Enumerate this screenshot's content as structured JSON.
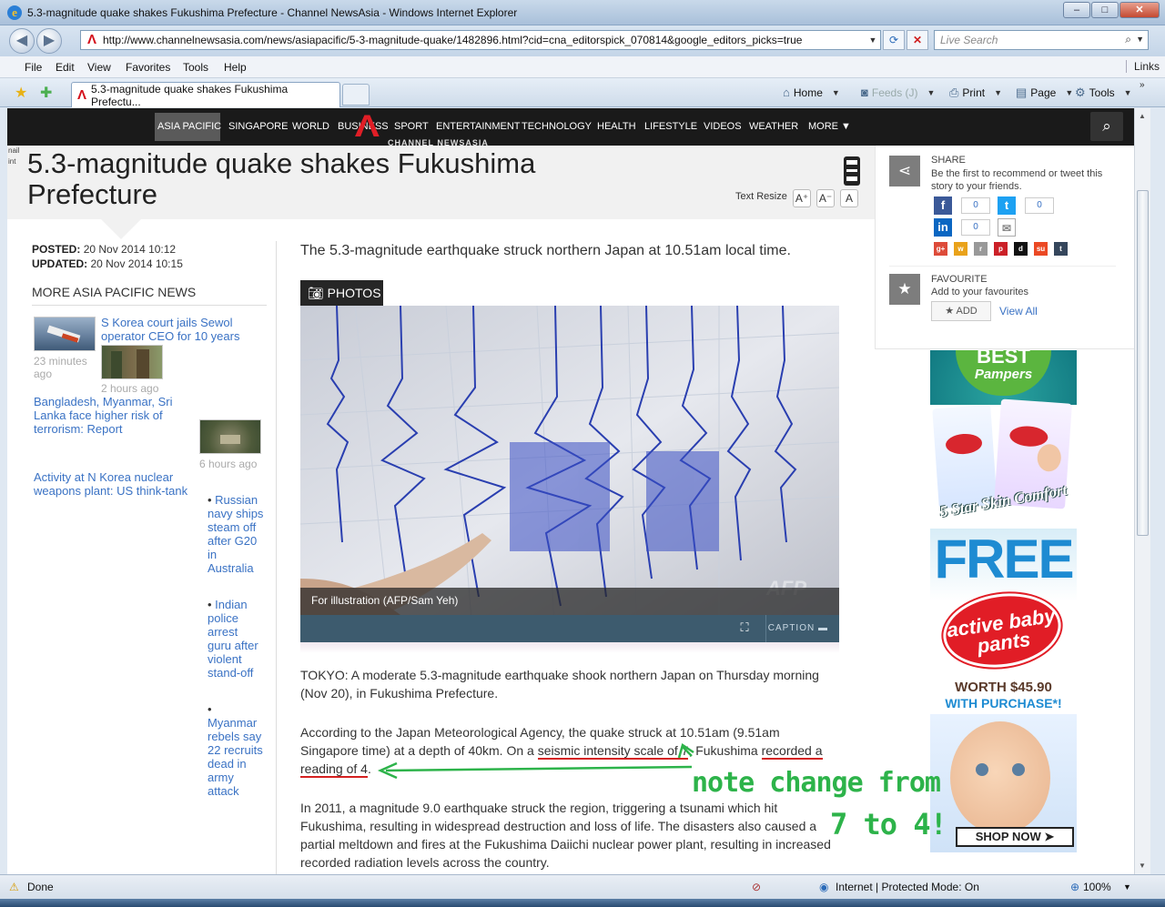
{
  "window": {
    "title": "5.3-magnitude quake shakes Fukushima Prefecture - Channel NewsAsia - Windows Internet Explorer",
    "buttons": {
      "minimize": "–",
      "maximize": "□",
      "close": "✕"
    }
  },
  "addressbar": {
    "url": "http://www.channelnewsasia.com/news/asiapacific/5-3-magnitude-quake/1482896.html?cid=cna_editorspick_070814&google_editors_picks=true",
    "search_placeholder": "Live Search"
  },
  "menu": {
    "items": [
      "File",
      "Edit",
      "View",
      "Favorites",
      "Tools",
      "Help"
    ],
    "links": "Links"
  },
  "tabs": {
    "active_title": "5.3-magnitude quake shakes Fukushima Prefectu..."
  },
  "commandbar": {
    "home": "Home",
    "feeds": "Feeds (J)",
    "print": "Print",
    "page": "Page",
    "tools": "Tools"
  },
  "sitenav": {
    "items": [
      "ASIA PACIFIC",
      "SINGAPORE",
      "WORLD",
      "BUSINESS",
      "SPORT",
      "ENTERTAINMENT",
      "TECHNOLOGY",
      "HEALTH",
      "LIFESTYLE",
      "VIDEOS",
      "WEATHER",
      "MORE ▼"
    ],
    "logo_text": "CHANNEL NEWSASIA"
  },
  "article": {
    "headline_line1": "5.3-magnitude quake shakes Fukushima",
    "headline_line2": "Prefecture",
    "tiny_text": "nail\nint",
    "text_resize": "Text Resize",
    "posted_label": "POSTED:",
    "posted_value": "20 Nov 2014 10:12",
    "updated_label": "UPDATED:",
    "updated_value": "20 Nov 2014 10:15",
    "lead": "The 5.3-magnitude earthquake struck northern Japan at 10.51am local time.",
    "photos_tab": "PHOTOS",
    "photo_caption": "For illustration (AFP/Sam Yeh)",
    "photo_watermark": "AFP",
    "caption_button": "CAPTION",
    "p1": "TOKYO: A moderate 5.3-magnitude earthquake shook northern Japan on Thursday morning (Nov 20), in Fukushima Prefecture.",
    "p2_a": "According to the Japan Meteorological Agency, the quake struck at 10.51am (9.51am Singapore time) at a depth of 40km. On a ",
    "p2_u1": "seismic intensity scale of 7",
    "p2_b": ", Fukushima ",
    "p2_u2": "recorded a reading of 4",
    "p2_c": ".",
    "p3": "In 2011, a magnitude 9.0 earthquake struck the region, triggering a tsunami which hit Fukushima, resulting in widespread destruction and loss of life. The disasters also caused a partial meltdown and fires at the Fukushima Daiichi nuclear power plant, resulting in increased recorded radiation levels across the country."
  },
  "more_news": {
    "title": "MORE ASIA PACIFIC NEWS",
    "items": [
      {
        "title": "S Korea court jails Sewol operator CEO for 10 years",
        "ago": "23 minutes ago"
      },
      {
        "title": "Bangladesh, Myanmar, Sri Lanka face higher risk of terrorism: Report",
        "ago": "2 hours ago"
      },
      {
        "title": "Activity at N Korea nuclear weapons plant: US think-tank",
        "ago": "6 hours ago"
      }
    ],
    "bullets": [
      "Russian navy ships steam off after G20 in Australia",
      "Indian police arrest guru after violent stand-off",
      "Myanmar rebels say 22 recruits dead in army attack"
    ]
  },
  "share": {
    "title": "SHARE",
    "subtitle": "Be the first to recommend or tweet this story to your friends.",
    "fb_count": "0",
    "tw_count": "0",
    "in_count": "0",
    "favourite_title": "FAVOURITE",
    "favourite_sub": "Add to your favourites",
    "add": "★ ADD",
    "view_all": "View All"
  },
  "ad": {
    "best": "BEST",
    "brand": "Pampers",
    "tagline": "5 Star Skin Comfort",
    "free": "FREE",
    "product": "active baby pants",
    "worth": "WORTH $45.90",
    "with": "WITH PURCHASE*!",
    "shop": "SHOP NOW ➤"
  },
  "annotation": {
    "line1": "note change from",
    "line2": "7 to 4!"
  },
  "statusbar": {
    "done": "Done",
    "zone": "Internet | Protected Mode: On",
    "zoom": "100%"
  },
  "colors": {
    "link": "#3a72c4",
    "annotation": "#2db34a",
    "underline": "#d42020",
    "brand_red": "#e01e26"
  }
}
